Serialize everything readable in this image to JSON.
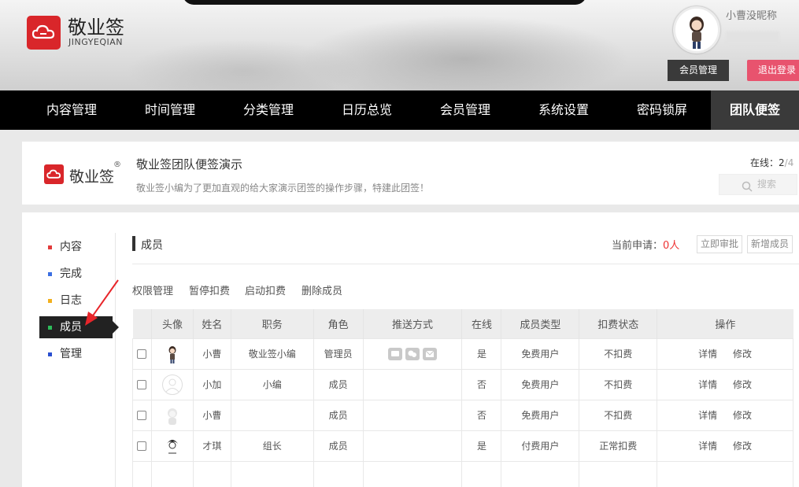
{
  "brand": {
    "name": "敬业签",
    "sub": "JINGYEQIAN",
    "reg": "®"
  },
  "user": {
    "nickname": "小曹没昵称",
    "member_btn": "会员管理",
    "logout_btn": "退出登录"
  },
  "nav": [
    "内容管理",
    "时间管理",
    "分类管理",
    "日历总览",
    "会员管理",
    "系统设置",
    "密码锁屏",
    "团队便签"
  ],
  "nav_active": "团队便签",
  "team": {
    "name": "敬业签团队便签演示",
    "desc": "敬业签小编为了更加直观的给大家演示团签的操作步骤，特建此团签！",
    "online_label": "在线：",
    "online_num": "2",
    "online_sep": "/",
    "online_total": "4",
    "search_placeholder": "搜索"
  },
  "sidebar": [
    {
      "label": "内容",
      "color": "#e23b3b"
    },
    {
      "label": "完成",
      "color": "#3b6fe2"
    },
    {
      "label": "日志",
      "color": "#f2b01e"
    },
    {
      "label": "成员",
      "color": "#2dbd5a"
    },
    {
      "label": "管理",
      "color": "#2a4fd0"
    }
  ],
  "members": {
    "title": "成员",
    "apply_label": "当前申请：",
    "apply_count": "0人",
    "approve_btn": "立即审批",
    "add_btn": "新增成员",
    "actions": [
      "权限管理",
      "暂停扣费",
      "启动扣费",
      "删除成员"
    ],
    "columns": [
      "",
      "头像",
      "姓名",
      "职务",
      "角色",
      "推送方式",
      "在线",
      "成员类型",
      "扣费状态",
      "操作"
    ],
    "rows": [
      {
        "name": "小曹",
        "title": "敬业签小编",
        "role": "管理员",
        "online": "是",
        "type": "免费用户",
        "billing": "不扣费",
        "detail": "详情",
        "edit": "修改"
      },
      {
        "name": "小加",
        "title": "小编",
        "role": "成员",
        "online": "否",
        "type": "免费用户",
        "billing": "不扣费",
        "detail": "详情",
        "edit": "修改"
      },
      {
        "name": "小曹",
        "title": "",
        "role": "成员",
        "online": "否",
        "type": "免费用户",
        "billing": "不扣费",
        "detail": "详情",
        "edit": "修改"
      },
      {
        "name": "才琪",
        "title": "组长",
        "role": "成员",
        "online": "是",
        "type": "付费用户",
        "billing": "正常扣费",
        "detail": "详情",
        "edit": "修改"
      }
    ]
  }
}
